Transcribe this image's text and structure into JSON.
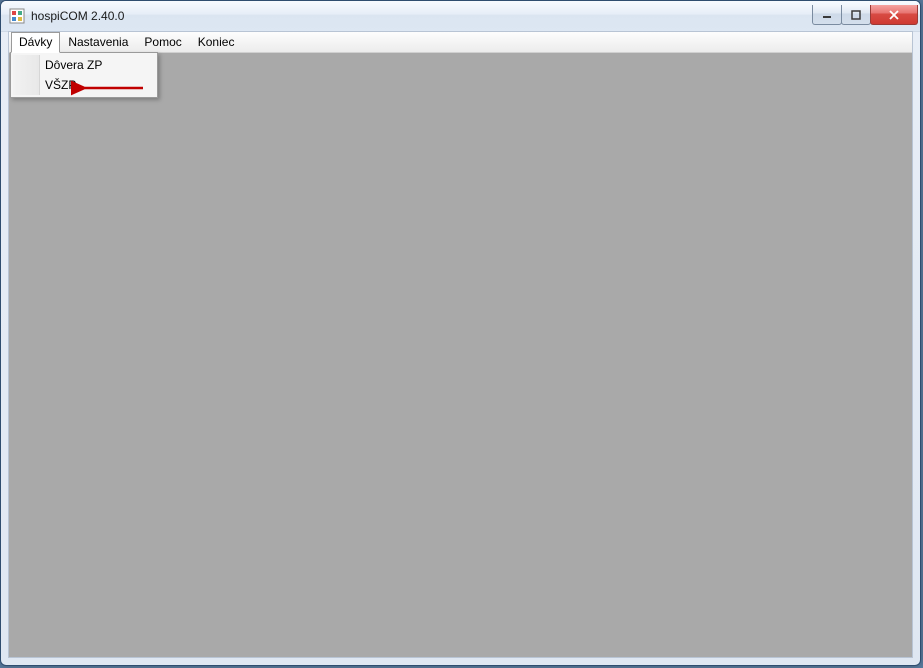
{
  "window": {
    "title": "hospiCOM 2.40.0"
  },
  "menubar": {
    "items": [
      {
        "label": "Dávky",
        "open": true
      },
      {
        "label": "Nastavenia",
        "open": false
      },
      {
        "label": "Pomoc",
        "open": false
      },
      {
        "label": "Koniec",
        "open": false
      }
    ]
  },
  "dropdown": {
    "items": [
      {
        "label": "Dôvera ZP"
      },
      {
        "label": "VŠZP"
      }
    ]
  },
  "annotation": {
    "arrow_to": "VŠZP",
    "color": "#c00000"
  }
}
